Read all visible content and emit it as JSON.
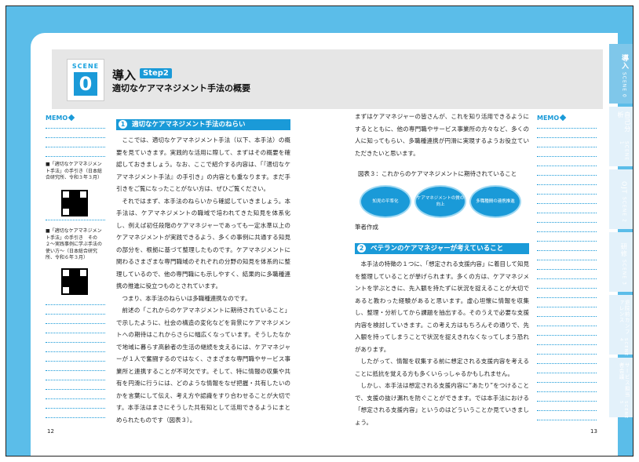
{
  "header": {
    "scene_label": "SCENE",
    "scene_number": "0",
    "title": "導入",
    "step_badge": "Step2",
    "subtitle": "適切なケアマネジメント手法の概要"
  },
  "side_tabs": [
    {
      "title": "導入",
      "scene": "SCENE 0",
      "active": true
    },
    {
      "title": "自己分析",
      "scene": "SCENE 1",
      "active": false
    },
    {
      "title": "OJT",
      "scene": "SCENE 2",
      "active": false
    },
    {
      "title": "研修",
      "scene": "SCENE 3",
      "active": false
    },
    {
      "title": "退院前カンファレンス",
      "scene": "SCENE 4",
      "active": false
    },
    {
      "title": "サービス担当者会議",
      "scene": "SCENE 5",
      "active": false
    }
  ],
  "memo": {
    "label": "MEMO",
    "notes": [
      "■「適切なケアマネジメント手法」の手引き（日本総合研究所、令和３年３月）",
      "■「適切なケアマネジメント手法」の手引き　その２〜実践事例に学ぶ手法の使い方〜（日本総合研究所、令和６年３月）"
    ]
  },
  "section1": {
    "number": "1",
    "title": "適切なケアマネジメント手法のねらい",
    "paragraphs": [
      "ここでは、適切なケアマネジメント手法（以下、本手法）の概要を見ていきます。実践的な活用に際して、まずはその概要を確認しておきましょう。なお、ここで紹介する内容は、「『適切なケアマネジメント手法』の手引き」の内容とも重なります。まだ手引きをご覧になったことがない方は、ぜひご覧ください。",
      "それではまず、本手法のねらいから確認していきましょう。本手法は、ケアマネジメントの職域で培われてきた知見を体系化し、例えば初任段階のケアマネジャーであっても一定水準以上のケアマネジメントが実践できるよう、多くの事例に共通する知見の部分を、根拠に基づて整理したものです。ケアマネジメントに関わるさまざまな専門職域のそれぞれの分野の知見を体系的に整理しているので、他の専門職にも示しやすく、結果的に多職種連携の推進に役立つものとされています。",
      "つまり、本手法のねらいは多職種連携なのです。",
      "前述の「これからのケアマネジメントに期待されていること」で示したように、社会の構造の変化などを背景にケアマネジメントへの期待はこれからさらに幅広くなっています。そうしたなかで地域に暮らす高齢者の生活の継続を支えるには、ケアマネジャーが１人で奮闘するのではなく、さまざまな専門職やサービス事業所と連携することが不可欠です。そして、特に情報の収集や共有を円滑に行うには、どのような情報をなぜ把握・共有したいのかを言葉にして伝え、考え方や認識をすり合わせることが大切です。本手法はまさにそうした共有知として活用できるようにまとめられたものです（図表３）。"
    ]
  },
  "right_intro": "まずはケアマネジャーの皆さんが、これを知り活用できるようにするとともに、他の専門職やサービス事業所の方々など、多くの人に知ってもらい、多職種連携が円滑に実現するようお役立ていただきたいと思います。",
  "figure": {
    "title": "図表３：これからのケアマネジメントに期待されていること",
    "items": [
      "知見の平準化",
      "ケアマネジメントの質の向上",
      "多職種間の連携推進"
    ],
    "credit": "筆者作成"
  },
  "section2": {
    "number": "2",
    "title": "ベテランのケアマネジャーが考えていること",
    "paragraphs": [
      "本手法の特徴の１つに、「想定される支援内容」に着目して知見を整理していることが挙げられます。多くの方は、ケアマネジメントを学ぶときに、先入観を持たずに状況を捉えることが大切であると教わった経験があると思います。虚心坦懐に情報を収集し、整理・分析してから課題を抽出する。そのうえで必要な支援内容を検討していきます。この考え方はもちろんその通りで、先入観を持ってしまうことで状況を捉えきれなくなってしまう恐れがあります。",
      "したがって、情報を収集する前に想定される支援内容を考えることに抵抗を覚える方も多くいらっしゃるかもしれません。",
      "しかし、本手法は想定される支援内容に“あたり”をつけることで、支援の抜け漏れを防ぐことができます。では本手法における「想定される支援内容」というのはどういうことか見ていきましょう。"
    ]
  },
  "page_numbers": {
    "left": "12",
    "right": "13"
  }
}
